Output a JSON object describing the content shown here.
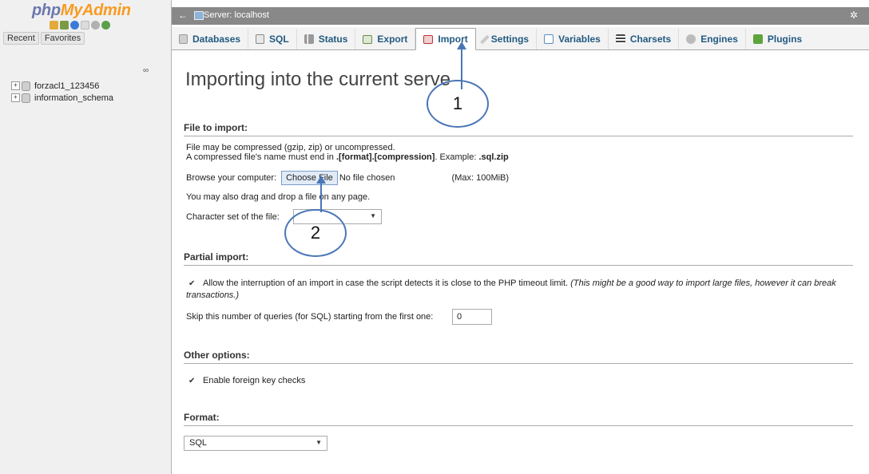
{
  "sidebar": {
    "logo_php": "php",
    "logo_myadmin": "MyAdmin",
    "recent_label": "Recent",
    "favorites_label": "Favorites",
    "databases": [
      "forzacl1_123456",
      "information_schema"
    ]
  },
  "topbar": {
    "back_glyph": "←",
    "server_label": "Server: localhost"
  },
  "tabs": [
    {
      "label": "Databases",
      "icon": "database-icon"
    },
    {
      "label": "SQL",
      "icon": "sql-icon"
    },
    {
      "label": "Status",
      "icon": "status-icon"
    },
    {
      "label": "Export",
      "icon": "export-icon"
    },
    {
      "label": "Import",
      "icon": "import-icon",
      "active": true
    },
    {
      "label": "Settings",
      "icon": "settings-icon"
    },
    {
      "label": "Variables",
      "icon": "variables-icon"
    },
    {
      "label": "Charsets",
      "icon": "charsets-icon"
    },
    {
      "label": "Engines",
      "icon": "engines-icon"
    },
    {
      "label": "Plugins",
      "icon": "plugins-icon"
    }
  ],
  "main": {
    "heading": "Importing into the current serve",
    "file_to_import": {
      "title": "File to import:",
      "line1": "File may be compressed (gzip, zip) or uncompressed.",
      "line2_prefix": "A compressed file's name must end in ",
      "line2_bold": ".[format].[compression]",
      "line2_mid": ". Example: ",
      "line2_example": ".sql.zip",
      "browse_label": "Browse your computer:",
      "choose_file": "Choose File",
      "no_file": "No file chosen",
      "max": "(Max: 100MiB)",
      "drag_text": "You may also drag and drop a file on any page.",
      "charset_label": "Character set of the file:"
    },
    "partial_import": {
      "title": "Partial import:",
      "allow_text": "Allow the interruption of an import in case the script detects it is close to the PHP timeout limit.",
      "allow_italic": "(This might be a good way to import large files, however it can break transactions.)",
      "skip_label": "Skip this number of queries (for SQL) starting from the first one:",
      "skip_value": "0"
    },
    "other_options": {
      "title": "Other options:",
      "fk_label": "Enable foreign key checks"
    },
    "format": {
      "title": "Format:",
      "selected": "SQL"
    }
  },
  "annotations": [
    "1",
    "2"
  ],
  "colors": {
    "accent": "#235a81",
    "annotation": "#4a76b6",
    "logo_blue": "#6c78af",
    "logo_orange": "#f89b21"
  }
}
